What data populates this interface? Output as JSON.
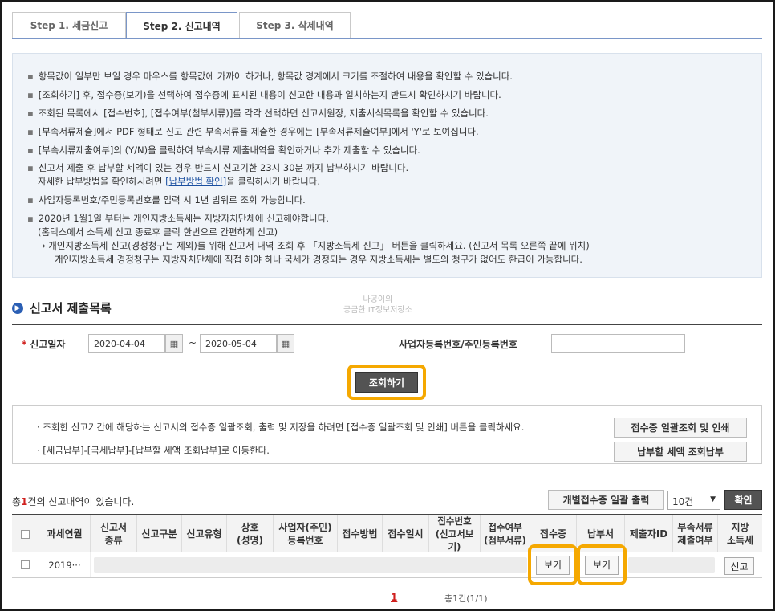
{
  "tabs": [
    {
      "label": "Step 1. 세금신고"
    },
    {
      "label": "Step 2. 신고내역"
    },
    {
      "label": "Step 3. 삭제내역"
    }
  ],
  "notice": {
    "items": [
      "항목값이 일부만 보일 경우 마우스를 항목값에 가까이 하거나, 항목값 경계에서 크기를 조절하여 내용을 확인할 수 있습니다.",
      "[조회하기] 후, 접수증(보기)을 선택하여 접수증에 표시된 내용이 신고한 내용과 일치하는지 반드시 확인하시기 바랍니다.",
      "조회된 목록에서 [접수번호], [접수여부(첨부서류)]를 각각 선택하면 신고서원장, 제출서식목록을 확인할 수 있습니다.",
      "[부속서류제출]에서 PDF 형태로 신고 관련 부속서류를 제출한 경우에는 [부속서류제출여부]에서 'Y'로 보여집니다.",
      "[부속서류제출여부]의 (Y/N)을 클릭하여 부속서류 제출내역을 확인하거나 추가 제출할 수 있습니다.",
      "신고서 제출 후 납부할 세액이 있는 경우 반드시 신고기한 23시 30분 까지 납부하시기 바랍니다."
    ],
    "pay_line_pre": "자세한 납부방법을 확인하시려면 ",
    "pay_link": "[납부방법 확인]",
    "pay_line_post": "을 클릭하시기 바랍니다.",
    "item7": "사업자등록번호/주민등록번호를 입력 시 1년 범위로 조회 가능합니다.",
    "item8_l1": "2020년 1월1일 부터는 개인지방소득세는 지방자치단체에 신고해야합니다.",
    "item8_l2": "(홈택스에서 소득세 신고 종료후 클릭 한번으로 간편하게 신고)",
    "item8_l3": "→ 개인지방소득세 신고(경정청구는 제외)를 위해 신고서 내역 조회 후 「지방소득세 신고」 버튼을 클릭하세요. (신고서 목록 오른쪽 끝에 위치)",
    "item8_l4": "개인지방소득세 경정청구는 지방자치단체에 직접 해야 하나 국세가 경정되는 경우 지방소득세는 별도의 청구가 없어도 환급이 가능합니다."
  },
  "section_title": "신고서 제출목록",
  "watermark": {
    "line1": "나공이의",
    "line2": "궁금한 IT정보저장소"
  },
  "search": {
    "date_label": "신고일자",
    "date_from": "2020-04-04",
    "date_to": "2020-05-04",
    "tilde": "~",
    "id_label": "사업자등록번호/주민등록번호",
    "id_value": ""
  },
  "query_button": "조회하기",
  "info": {
    "line1": "· 조회한 신고기간에 해당하는 신고서의 접수증 일괄조회, 출력 및 저장을 하려면 [접수증 일괄조회 및 인쇄] 버튼을 클릭하세요.",
    "line2": "· [세금납부]-[국세납부]-[납부할 세액 조회납부]로 이동한다.",
    "btn_batch": "접수증 일괄조회 및 인쇄",
    "btn_pay": "납부할 세액 조회납부"
  },
  "count": {
    "pre": "총",
    "num": "1",
    "post": "건의 신고내역이 있습니다."
  },
  "btn_bulk_print": "개별접수증 일괄 출력",
  "page_size": "10건",
  "btn_ok": "확인",
  "columns": [
    "",
    "과세연월",
    "신고서\n종류",
    "신고구분",
    "신고유형",
    "상호\n(성명)",
    "사업자(주민)\n등록번호",
    "접수방법",
    "접수일시",
    "접수번호\n(신고서보기)",
    "접수여부\n(첨부서류)",
    "접수증",
    "납부서",
    "제출자ID",
    "부속서류\n제출여부",
    "지방\n소득세"
  ],
  "row": {
    "period": "2019···",
    "receipt_btn": "보기",
    "payment_btn": "보기",
    "local_tax_btn": "신고"
  },
  "pager": {
    "current": "1",
    "total": "총1건(1/1)"
  }
}
